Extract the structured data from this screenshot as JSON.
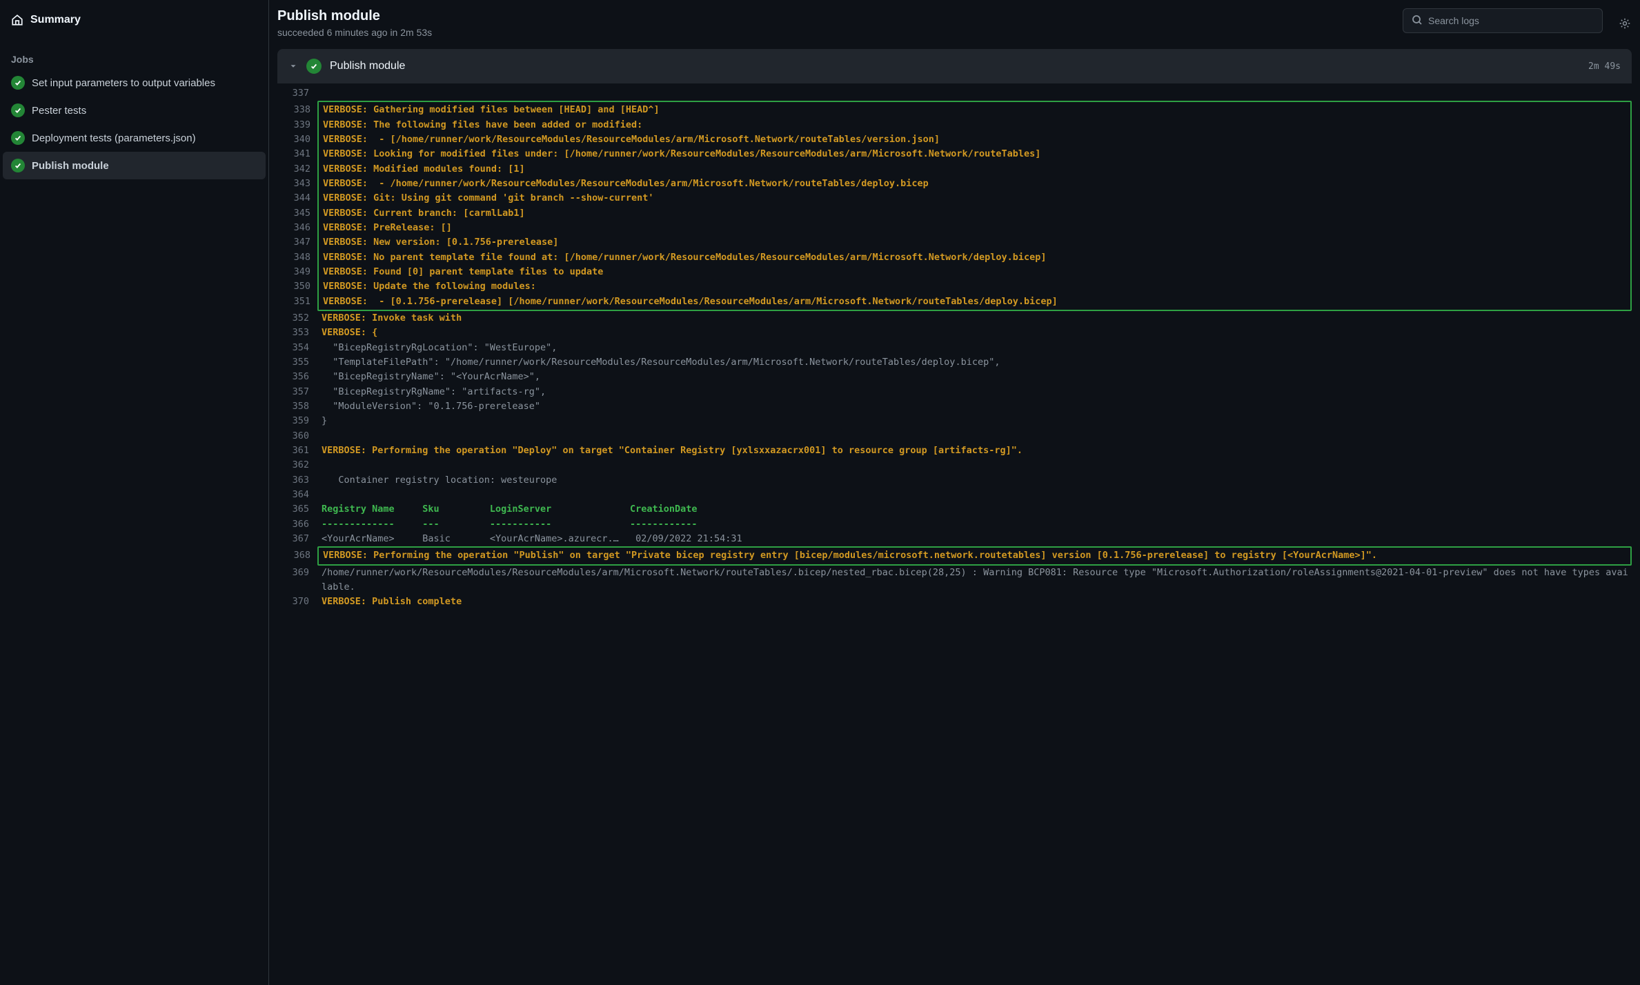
{
  "sidebar": {
    "summary": "Summary",
    "jobs_label": "Jobs",
    "items": [
      {
        "label": "Set input parameters to output variables",
        "active": false
      },
      {
        "label": "Pester tests",
        "active": false
      },
      {
        "label": "Deployment tests (parameters.json)",
        "active": false
      },
      {
        "label": "Publish module",
        "active": true
      }
    ]
  },
  "header": {
    "title": "Publish module",
    "subtitle": "succeeded 6 minutes ago in 2m 53s",
    "search_placeholder": "Search logs"
  },
  "step": {
    "title": "Publish module",
    "duration": "2m 49s"
  },
  "log": {
    "lines": [
      {
        "n": 337,
        "cls": "verbose",
        "t": "",
        "hl": 0
      },
      {
        "n": 338,
        "cls": "verbose",
        "t": "VERBOSE: Gathering modified files between [HEAD] and [HEAD^]",
        "hl": 1
      },
      {
        "n": 339,
        "cls": "verbose",
        "t": "VERBOSE: The following files have been added or modified:",
        "hl": 1
      },
      {
        "n": 340,
        "cls": "verbose",
        "t": "VERBOSE:  - [/home/runner/work/ResourceModules/ResourceModules/arm/Microsoft.Network/routeTables/version.json]",
        "hl": 1
      },
      {
        "n": 341,
        "cls": "verbose",
        "t": "VERBOSE: Looking for modified files under: [/home/runner/work/ResourceModules/ResourceModules/arm/Microsoft.Network/routeTables]",
        "hl": 1
      },
      {
        "n": 342,
        "cls": "verbose",
        "t": "VERBOSE: Modified modules found: [1]",
        "hl": 1
      },
      {
        "n": 343,
        "cls": "verbose",
        "t": "VERBOSE:  - /home/runner/work/ResourceModules/ResourceModules/arm/Microsoft.Network/routeTables/deploy.bicep",
        "hl": 1
      },
      {
        "n": 344,
        "cls": "verbose",
        "t": "VERBOSE: Git: Using git command 'git branch --show-current'",
        "hl": 1
      },
      {
        "n": 345,
        "cls": "verbose",
        "t": "VERBOSE: Current branch: [carmlLab1]",
        "hl": 1
      },
      {
        "n": 346,
        "cls": "verbose",
        "t": "VERBOSE: PreRelease: []",
        "hl": 1
      },
      {
        "n": 347,
        "cls": "verbose",
        "t": "VERBOSE: New version: [0.1.756-prerelease]",
        "hl": 1
      },
      {
        "n": 348,
        "cls": "verbose",
        "t": "VERBOSE: No parent template file found at: [/home/runner/work/ResourceModules/ResourceModules/arm/Microsoft.Network/deploy.bicep]",
        "hl": 1
      },
      {
        "n": 349,
        "cls": "verbose",
        "t": "VERBOSE: Found [0] parent template files to update",
        "hl": 1
      },
      {
        "n": 350,
        "cls": "verbose",
        "t": "VERBOSE: Update the following modules:",
        "hl": 1
      },
      {
        "n": 351,
        "cls": "verbose",
        "t": "VERBOSE:  - [0.1.756-prerelease] [/home/runner/work/ResourceModules/ResourceModules/arm/Microsoft.Network/routeTables/deploy.bicep]",
        "hl": 1
      },
      {
        "n": 352,
        "cls": "verbose",
        "t": "VERBOSE: Invoke task with",
        "hl": 0
      },
      {
        "n": 353,
        "cls": "verbose",
        "t": "VERBOSE: {",
        "hl": 0
      },
      {
        "n": 354,
        "cls": "plain",
        "t": "  \"BicepRegistryRgLocation\": \"WestEurope\",",
        "hl": 0
      },
      {
        "n": 355,
        "cls": "plain",
        "t": "  \"TemplateFilePath\": \"/home/runner/work/ResourceModules/ResourceModules/arm/Microsoft.Network/routeTables/deploy.bicep\",",
        "hl": 0
      },
      {
        "n": 356,
        "cls": "plain",
        "t": "  \"BicepRegistryName\": \"<YourAcrName>\",",
        "hl": 0
      },
      {
        "n": 357,
        "cls": "plain",
        "t": "  \"BicepRegistryRgName\": \"artifacts-rg\",",
        "hl": 0
      },
      {
        "n": 358,
        "cls": "plain",
        "t": "  \"ModuleVersion\": \"0.1.756-prerelease\"",
        "hl": 0
      },
      {
        "n": 359,
        "cls": "plain",
        "t": "}",
        "hl": 0
      },
      {
        "n": 360,
        "cls": "plain",
        "t": "",
        "hl": 0
      },
      {
        "n": 361,
        "cls": "verbose",
        "t": "VERBOSE: Performing the operation \"Deploy\" on target \"Container Registry [yxlsxxazacrx001] to resource group [artifacts-rg]\".",
        "hl": 0
      },
      {
        "n": 362,
        "cls": "plain",
        "t": "",
        "hl": 0
      },
      {
        "n": 363,
        "cls": "plain",
        "t": "   Container registry location: westeurope",
        "hl": 0
      },
      {
        "n": 364,
        "cls": "plain",
        "t": "",
        "hl": 0
      },
      {
        "n": 365,
        "cls": "greentxt",
        "t": "Registry Name     Sku         LoginServer              CreationDate",
        "hl": 0
      },
      {
        "n": 366,
        "cls": "greentxt",
        "t": "-------------     ---         -----------              ------------",
        "hl": 0
      },
      {
        "n": 367,
        "cls": "plain",
        "t": "<YourAcrName>     Basic       <YourAcrName>.azurecr.…   02/09/2022 21:54:31",
        "hl": 0
      },
      {
        "n": 368,
        "cls": "verbose",
        "t": "VERBOSE: Performing the operation \"Publish\" on target \"Private bicep registry entry [bicep/modules/microsoft.network.routetables] version [0.1.756-prerelease] to registry [<YourAcrName>]\".",
        "hl": 2
      },
      {
        "n": 369,
        "cls": "plain",
        "t": "/home/runner/work/ResourceModules/ResourceModules/arm/Microsoft.Network/routeTables/.bicep/nested_rbac.bicep(28,25) : Warning BCP081: Resource type \"Microsoft.Authorization/roleAssignments@2021-04-01-preview\" does not have types available.",
        "hl": 0
      },
      {
        "n": 370,
        "cls": "verbose",
        "t": "VERBOSE: Publish complete",
        "hl": 0
      }
    ]
  }
}
